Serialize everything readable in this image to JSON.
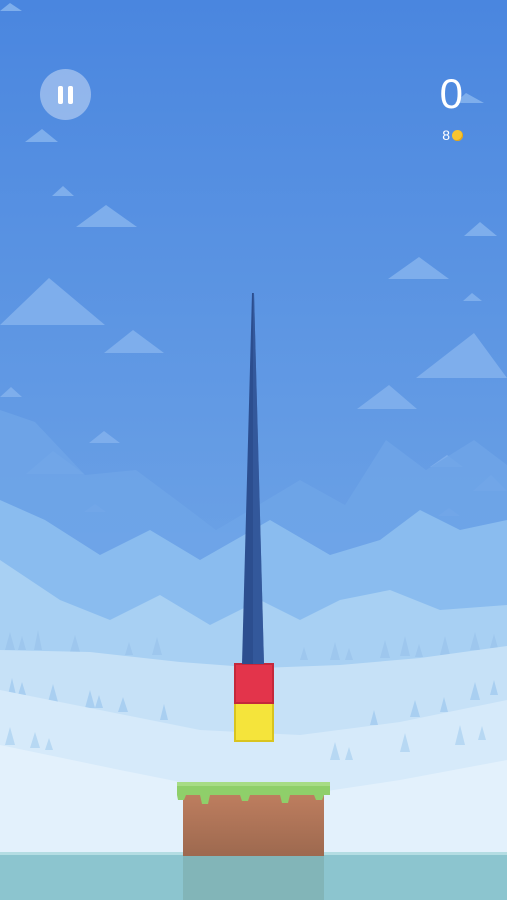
{
  "hud": {
    "score": "0",
    "coins": "8",
    "pause_icon": "pause-icon",
    "coin_icon": "coin-icon"
  },
  "colors": {
    "sky_top": "#4a86df",
    "sky_bottom": "#7fb2ea",
    "cloud": "#7eaeec",
    "mountain_far": "#6fa5e8",
    "mountain_mid": "#8abcef",
    "mountain_near": "#a8d0f3",
    "snow_light": "#dceefb",
    "snow_mid": "#c6e1f7",
    "tree": "#9ec7ee",
    "spike": "#2c4e8f",
    "block_red": "#e3344b",
    "block_yellow": "#f5e43b",
    "grass": "#8fcf6a",
    "dirt": "#b7795a",
    "water": "#8cc5cf"
  }
}
